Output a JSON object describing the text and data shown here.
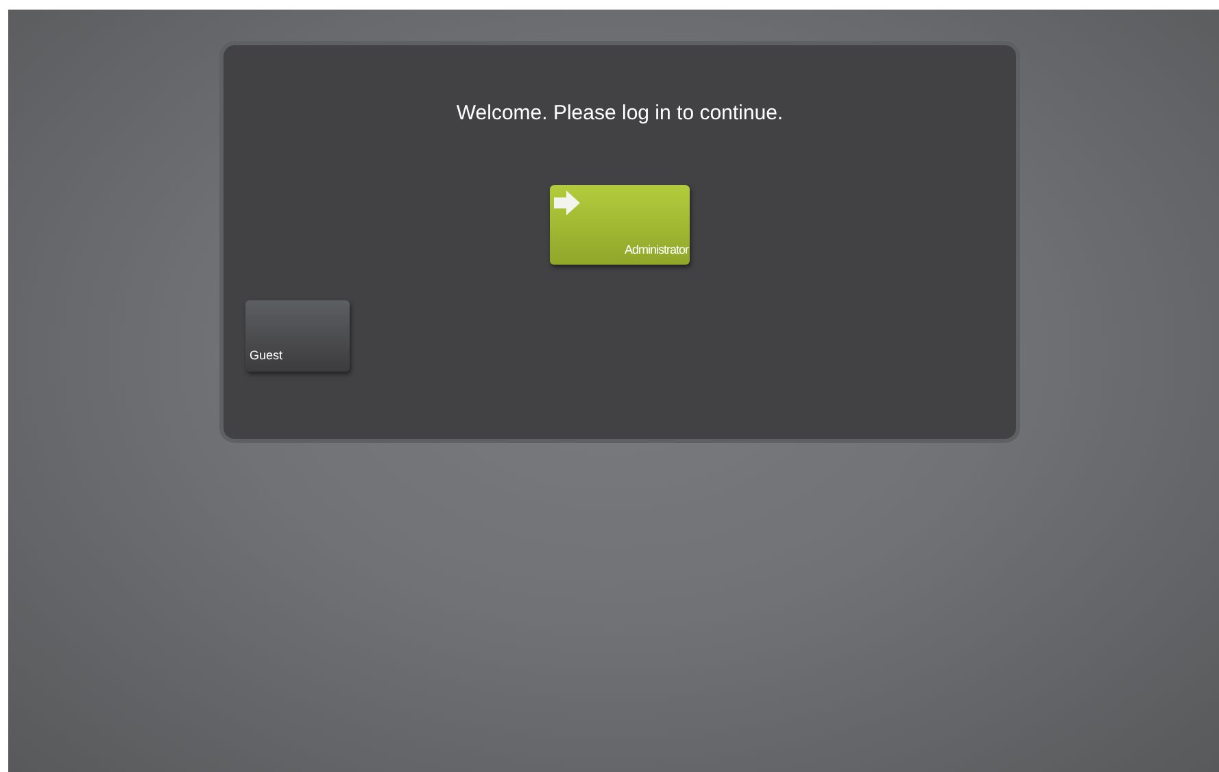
{
  "prompt": "Welcome. Please log in to continue.",
  "accounts": [
    {
      "name": "Administrator",
      "selected": true
    },
    {
      "name": "Guest",
      "selected": false
    }
  ]
}
